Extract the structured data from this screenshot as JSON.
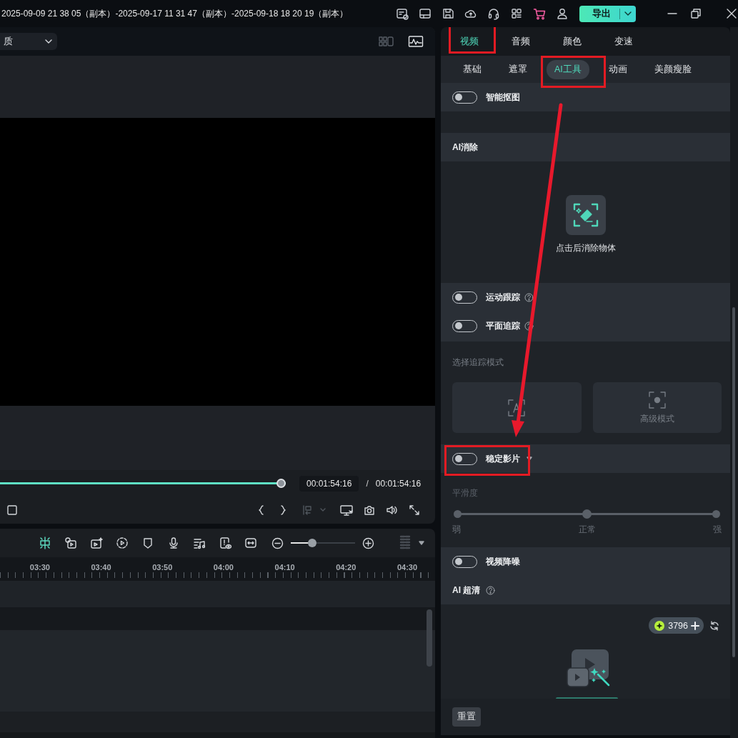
{
  "title_bar": {
    "title": "2025-09-09 21 38 05（副本）-2025-09-17 11 31 47（副本）-2025-09-18 18 20 19（副本）",
    "export_button": "导出"
  },
  "preview": {
    "quality_dropdown": "质",
    "progress": {
      "level": 1
    },
    "current_time": "00:01:54:16",
    "time_separator": "/",
    "total_time": "00:01:54:16"
  },
  "timeline": {
    "zoom": {
      "level": 0.31
    },
    "ruler": [
      "03:30",
      "03:40",
      "03:50",
      "04:00",
      "04:10",
      "04:20",
      "04:30"
    ]
  },
  "inspector": {
    "tabs": [
      {
        "label": "视频",
        "selected": true,
        "highlighted": true
      },
      {
        "label": "音频",
        "selected": false,
        "highlighted": false
      },
      {
        "label": "颜色",
        "selected": false,
        "highlighted": false
      },
      {
        "label": "变速",
        "selected": false,
        "highlighted": false
      }
    ],
    "subtabs": [
      {
        "label": "基础",
        "selected": false,
        "highlighted": false
      },
      {
        "label": "遮罩",
        "selected": false,
        "highlighted": false
      },
      {
        "label": "AI工具",
        "selected": true,
        "highlighted": true
      },
      {
        "label": "动画",
        "selected": false,
        "highlighted": false
      },
      {
        "label": "美颜瘦脸",
        "selected": false,
        "highlighted": false
      }
    ],
    "smart_cutout": {
      "label": "智能抠图",
      "on": false
    },
    "ai_erase": {
      "title": "AI消除",
      "action": "点击后消除物体"
    },
    "motion_tracking": {
      "label": "运动跟踪",
      "on": false
    },
    "planar_tracking": {
      "label": "平面追踪",
      "on": false
    },
    "tracking_mode": {
      "label": "选择追踪模式",
      "disabled": true,
      "modes": [
        {
          "kind": "basic"
        },
        {
          "kind": "advanced",
          "label": "高级模式"
        }
      ]
    },
    "stabilize": {
      "label": "稳定影片",
      "on": false,
      "highlighted": true
    },
    "smoothness": {
      "label": "平滑度",
      "level": 0.5,
      "disabled": true,
      "marks": [
        "弱",
        "正常",
        "强"
      ]
    },
    "denoise": {
      "label": "视频降噪",
      "on": false
    },
    "ai_upscale": {
      "title": "AI 超清",
      "credits": "3796"
    },
    "reset_button": "重置"
  },
  "annotation": {
    "kind": "arrow"
  }
}
